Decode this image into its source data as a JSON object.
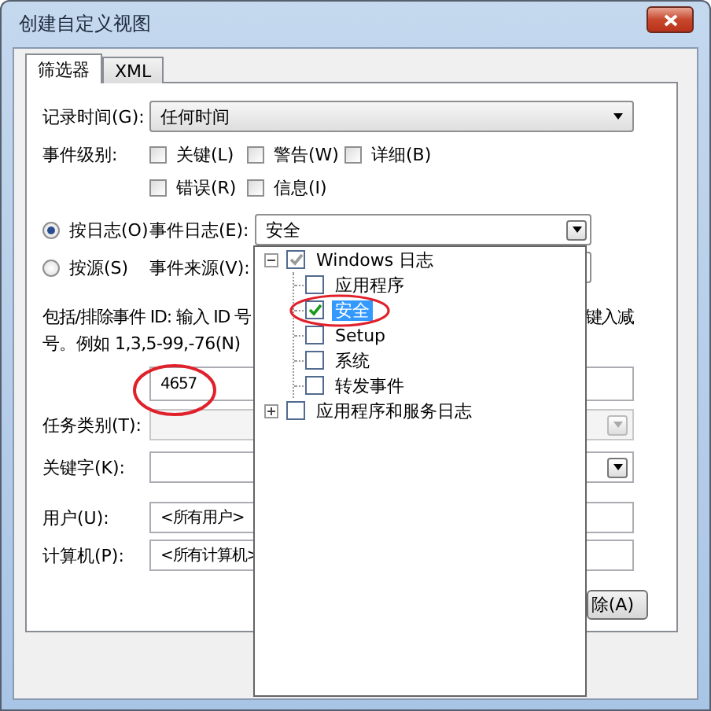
{
  "window": {
    "title": "创建自定义视图"
  },
  "tabs": [
    {
      "label": "筛选器",
      "selected": true
    },
    {
      "label": "XML",
      "selected": false
    }
  ],
  "logged": {
    "label": "记录时间(G):",
    "value": "任何时间"
  },
  "event_level": {
    "label": "事件级别:",
    "rows": [
      [
        {
          "label": "关键(L)",
          "checked": false
        },
        {
          "label": "警告(W)",
          "checked": false
        },
        {
          "label": "详细(B)",
          "checked": false
        }
      ],
      [
        {
          "label": "错误(R)",
          "checked": false
        },
        {
          "label": "信息(I)",
          "checked": false
        }
      ]
    ]
  },
  "sources": [
    {
      "label": "按日志(O)",
      "selected": true,
      "field_label": "事件日志(E):",
      "value": "安全"
    },
    {
      "label": "按源(S)",
      "selected": false,
      "field_label": "事件来源(V):"
    }
  ],
  "event_id": {
    "hint_start": "包括/排除事件 ID: 输入 ID 号",
    "hint_end": "键入减",
    "hint_line2": "号。例如 1,3,5-99,-76(N)",
    "value": "4657"
  },
  "fields": [
    {
      "kind": "combo",
      "label": "任务类别(T):",
      "disabled": true
    },
    {
      "kind": "combo",
      "label": "关键字(K):",
      "disabled": false
    },
    {
      "kind": "text",
      "label": "用户(U):",
      "value": "<所有用户>"
    },
    {
      "kind": "text",
      "label": "计算机(P):",
      "value": "<所有计算机>"
    }
  ],
  "button": "除(A)",
  "log_tree": [
    {
      "label": "Windows 日志",
      "checked": true,
      "partial": true,
      "selected": false,
      "expanded": true,
      "children": [
        {
          "label": "应用程序",
          "checked": false,
          "selected": false
        },
        {
          "label": "安全",
          "checked": true,
          "selected": true
        },
        {
          "label": "Setup",
          "checked": false,
          "selected": false
        },
        {
          "label": "系统",
          "checked": false,
          "selected": false
        },
        {
          "label": "转发事件",
          "checked": false,
          "selected": false
        }
      ]
    },
    {
      "label": "应用程序和服务日志",
      "checked": false,
      "selected": false,
      "expanded": false
    }
  ]
}
